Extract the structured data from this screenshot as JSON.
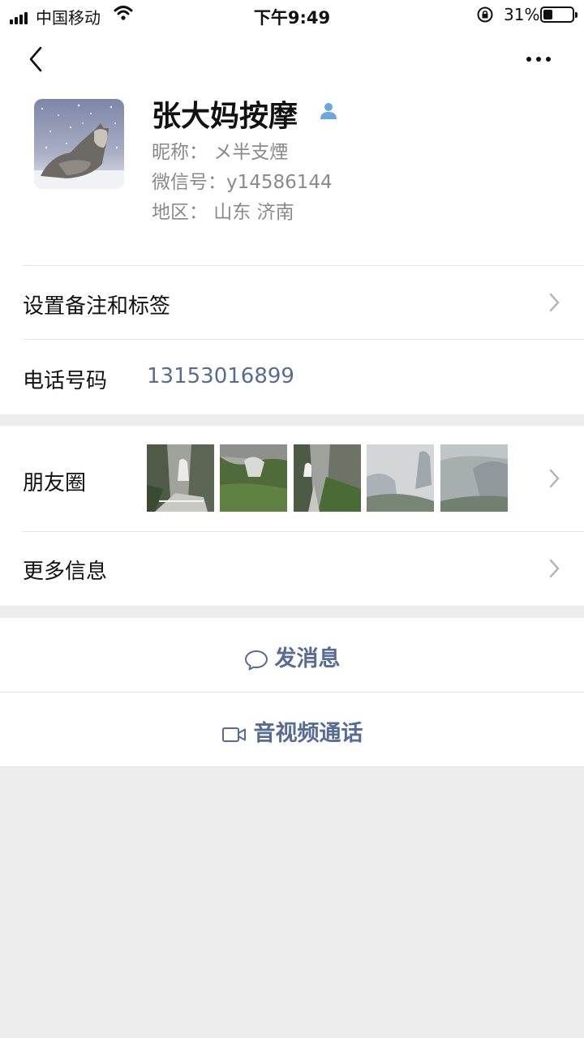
{
  "status_bar": {
    "carrier": "中国移动",
    "time": "下午9:49",
    "battery_percent": "31%",
    "battery_level": 0.31
  },
  "nav": {
    "back_icon": "chevron-left-icon",
    "more_icon": "more-horizontal-icon"
  },
  "profile": {
    "name": "张大妈按摩",
    "nickname_line": "昵称： メ半支煙",
    "wechat_id_line": "微信号：y14586144",
    "region_line": "地区：  山东 济南",
    "badge_icon": "person-icon"
  },
  "rows": {
    "remark_label": "设置备注和标签",
    "phone_label": "电话号码",
    "phone_value": "13153016899",
    "moments_label": "朋友圈",
    "more_info_label": "更多信息"
  },
  "actions": {
    "message_label": "发消息",
    "message_icon": "chat-bubble-icon",
    "call_label": "音视频通话",
    "call_icon": "video-camera-icon"
  },
  "colors": {
    "link_blue": "#576b95",
    "background": "#ededed",
    "secondary_text": "#8a8a8a"
  }
}
